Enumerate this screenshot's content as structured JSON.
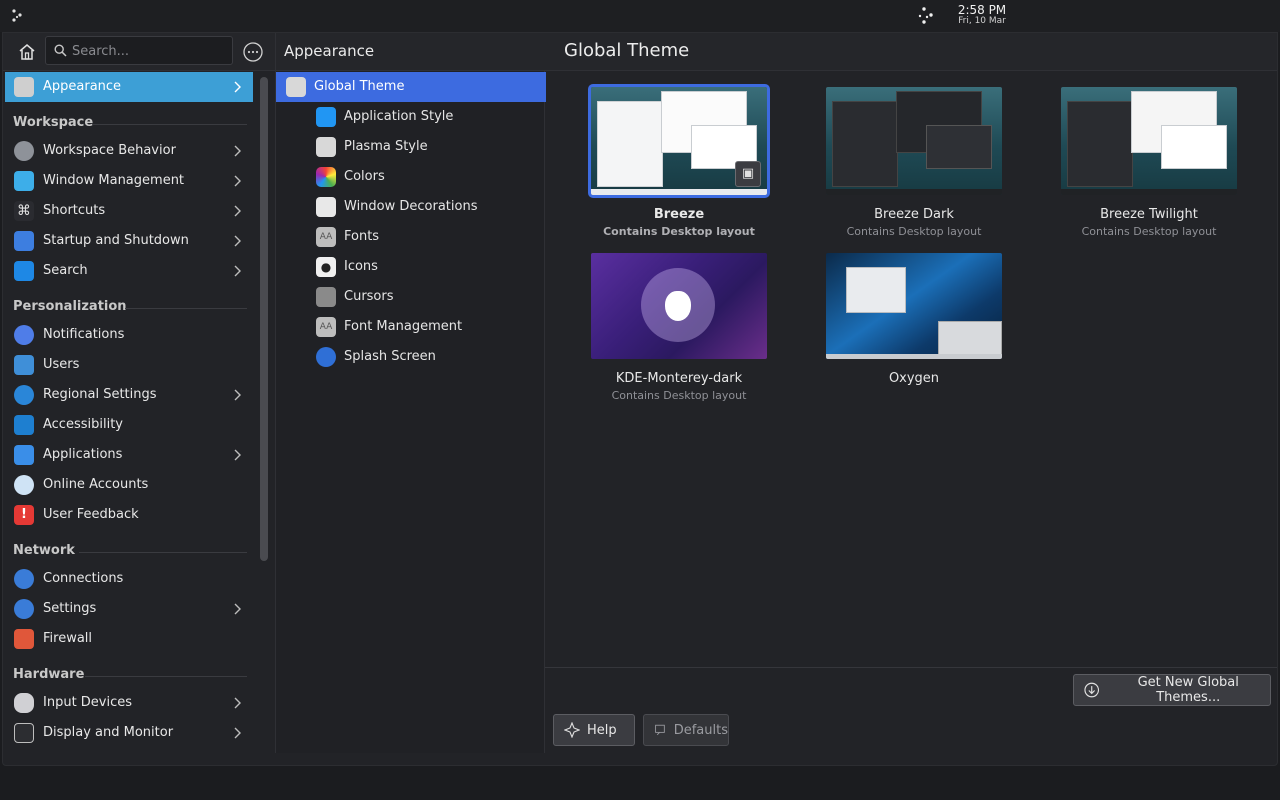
{
  "panel": {
    "time": "2:58 PM",
    "date": "Fri, 10 Mar"
  },
  "sidebar": {
    "search_placeholder": "Search...",
    "items": [
      {
        "label": "Appearance",
        "icon": "appearance-icon",
        "color": "#d8d8d8",
        "chevron": true,
        "active": true
      },
      {
        "label": "Workspace Behavior",
        "icon": "workspace-icon",
        "color": "#8e9299",
        "chevron": true
      },
      {
        "label": "Window Management",
        "icon": "window-icon",
        "color": "#3daee9",
        "chevron": true
      },
      {
        "label": "Shortcuts",
        "icon": "shortcuts-icon",
        "color": "#2a2b30",
        "chevron": true
      },
      {
        "label": "Startup and Shutdown",
        "icon": "startup-icon",
        "color": "#3d7ee0",
        "chevron": true
      },
      {
        "label": "Search",
        "icon": "search-settings-icon",
        "color": "#1e88e5",
        "chevron": true
      },
      {
        "label": "Notifications",
        "icon": "notifications-icon",
        "color": "#4f7de8",
        "chevron": false
      },
      {
        "label": "Users",
        "icon": "users-icon",
        "color": "#3f8fd8",
        "chevron": false
      },
      {
        "label": "Regional Settings",
        "icon": "regional-icon",
        "color": "#2a86d8",
        "chevron": true
      },
      {
        "label": "Accessibility",
        "icon": "accessibility-icon",
        "color": "#1e7fd0",
        "chevron": false
      },
      {
        "label": "Applications",
        "icon": "applications-icon",
        "color": "#3a8ee8",
        "chevron": true
      },
      {
        "label": "Online Accounts",
        "icon": "online-accounts-icon",
        "color": "#cfe3f5",
        "chevron": false
      },
      {
        "label": "User Feedback",
        "icon": "feedback-icon",
        "color": "#e53935",
        "chevron": false
      },
      {
        "label": "Connections",
        "icon": "connections-icon",
        "color": "#3a7cd8",
        "chevron": false
      },
      {
        "label": "Settings",
        "icon": "network-settings-icon",
        "color": "#3a7cd8",
        "chevron": true
      },
      {
        "label": "Firewall",
        "icon": "firewall-icon",
        "color": "#e0573a",
        "chevron": false
      },
      {
        "label": "Input Devices",
        "icon": "input-devices-icon",
        "color": "#d0d0d4",
        "chevron": true
      },
      {
        "label": "Display and Monitor",
        "icon": "display-icon",
        "color": "#2c2d31",
        "chevron": true
      }
    ],
    "sections": {
      "workspace": "Workspace",
      "personalization": "Personalization",
      "network": "Network",
      "hardware": "Hardware"
    }
  },
  "middle": {
    "heading": "Appearance",
    "items": [
      {
        "label": "Global Theme",
        "icon": "global-theme-icon",
        "color": "#d8d8d8",
        "active": true
      },
      {
        "label": "Application Style",
        "icon": "application-style-icon",
        "color": "#2196f3"
      },
      {
        "label": "Plasma Style",
        "icon": "plasma-style-icon",
        "color": "#d8d8d8"
      },
      {
        "label": "Colors",
        "icon": "colors-icon",
        "color": "#ffffff"
      },
      {
        "label": "Window Decorations",
        "icon": "window-decorations-icon",
        "color": "#e8e8e8"
      },
      {
        "label": "Fonts",
        "icon": "fonts-icon",
        "color": "#bdbdbd"
      },
      {
        "label": "Icons",
        "icon": "icons-icon",
        "color": "#f0f0f0"
      },
      {
        "label": "Cursors",
        "icon": "cursors-icon",
        "color": "#8a8a8a"
      },
      {
        "label": "Font Management",
        "icon": "font-management-icon",
        "color": "#bdbdbd"
      },
      {
        "label": "Splash Screen",
        "icon": "splash-screen-icon",
        "color": "#2f6fd6"
      }
    ]
  },
  "pane": {
    "heading": "Global Theme",
    "themes": [
      {
        "name": "Breeze",
        "sub": "Contains Desktop layout",
        "selected": true,
        "preview": "light"
      },
      {
        "name": "Breeze Dark",
        "sub": "Contains Desktop layout",
        "selected": false,
        "preview": "dark"
      },
      {
        "name": "Breeze Twilight",
        "sub": "Contains Desktop layout",
        "selected": false,
        "preview": "twilight"
      },
      {
        "name": "KDE-Monterey-dark",
        "sub": "Contains Desktop layout",
        "selected": false,
        "preview": "monterey"
      },
      {
        "name": "Oxygen",
        "sub": "",
        "selected": false,
        "preview": "oxygen"
      }
    ],
    "get_new_label": "Get New Global Themes...",
    "help_label": "Help",
    "defaults_label": "Defaults"
  },
  "colors": {
    "accent_sidebar": "#3d9fd6",
    "accent_selection": "#3d6be0"
  }
}
